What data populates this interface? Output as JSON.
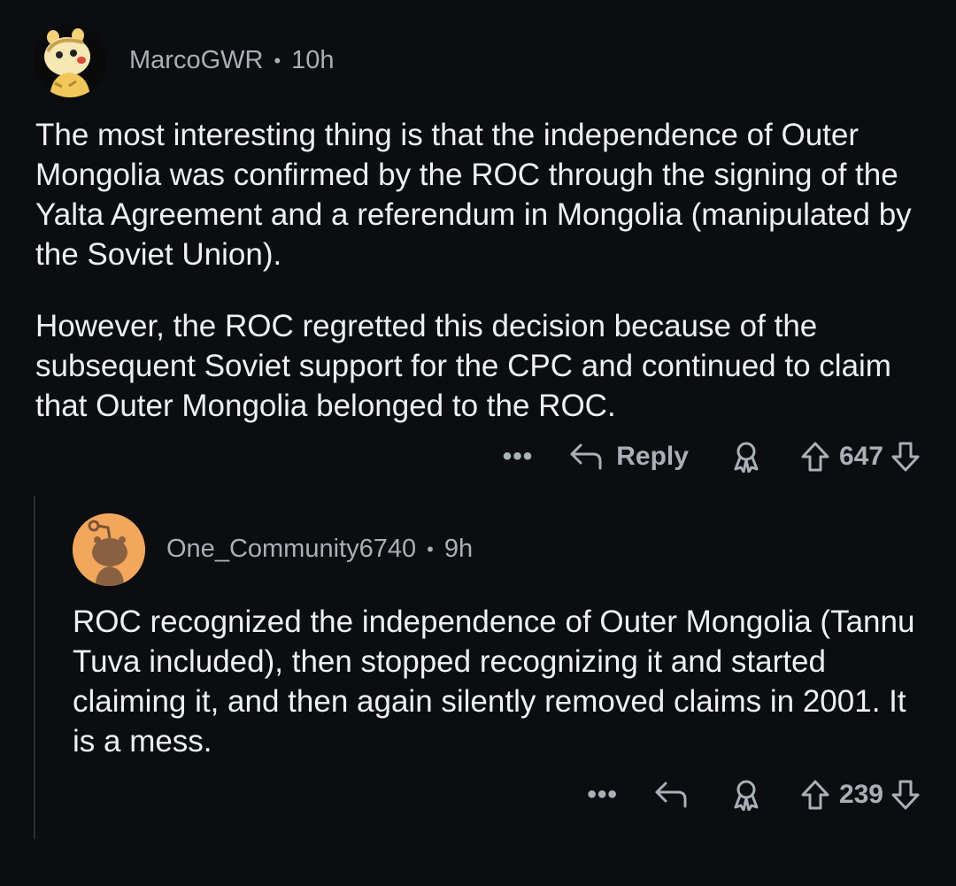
{
  "comments": [
    {
      "username": "MarcoGWR",
      "separator": "•",
      "time": "10h",
      "paragraphs": [
        "The most interesting thing is that the independence of Outer Mongolia was confirmed by the ROC through the signing of the Yalta Agreement and a referendum in Mongolia (manipulated by the Soviet Union).",
        "However, the ROC regretted this decision because of the subsequent Soviet support for the CPC and continued to claim that Outer Mongolia belonged to the ROC."
      ],
      "more_label": "•••",
      "reply_label": "Reply",
      "score": "647",
      "icons": [
        "more-icon",
        "reply-arrow-icon",
        "award-icon",
        "upvote-arrow-icon",
        "downvote-arrow-icon"
      ]
    },
    {
      "username": "One_Community6740",
      "separator": "•",
      "time": "9h",
      "paragraphs": [
        "ROC recognized the independence of Outer Mongolia (Tannu Tuva included), then stopped recognizing it and started claiming it, and then again silently removed claims in 2001. It is a mess."
      ],
      "more_label": "•••",
      "score": "239",
      "icons": [
        "more-icon",
        "reply-arrow-icon",
        "award-icon",
        "upvote-arrow-icon",
        "downvote-arrow-icon"
      ]
    }
  ],
  "colors": {
    "background": "#0b0d10",
    "text": "#eef0f2",
    "muted": "#a9b0b6",
    "thread_line": "#2a2e33",
    "avatar2_bg": "#f2a75c"
  }
}
